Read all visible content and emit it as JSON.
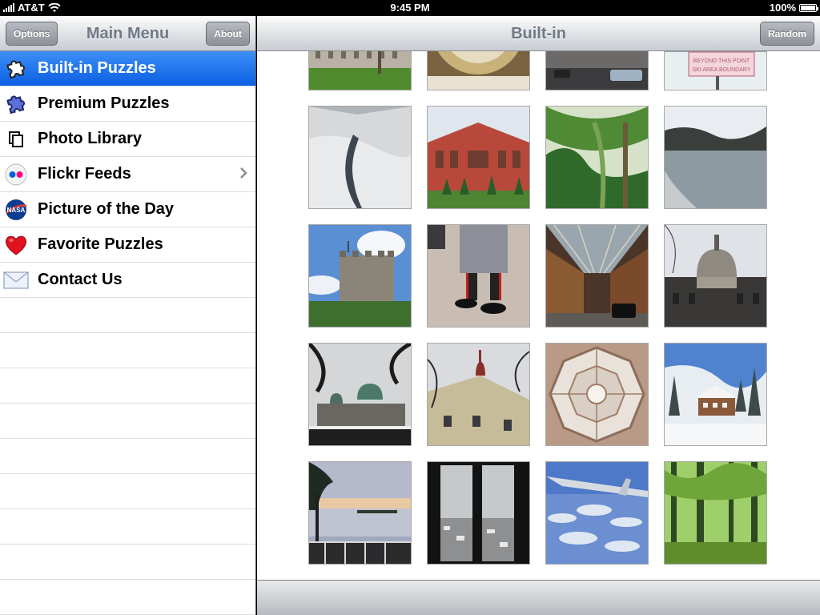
{
  "status_bar": {
    "carrier": "AT&T",
    "time": "9:45 PM",
    "battery": "100%",
    "battery_level": 1.0
  },
  "left_pane": {
    "options_button": "Options",
    "title": "Main Menu",
    "about_button": "About",
    "items": [
      {
        "label": "Built-in Puzzles",
        "icon": "puzzle-white-icon",
        "selected": true
      },
      {
        "label": "Premium Puzzles",
        "icon": "puzzle-blue-icon"
      },
      {
        "label": "Photo Library",
        "icon": "photo-library-icon"
      },
      {
        "label": "Flickr Feeds",
        "icon": "flickr-icon",
        "has_disclosure": true
      },
      {
        "label": "Picture of the Day",
        "icon": "nasa-icon"
      },
      {
        "label": "Favorite Puzzles",
        "icon": "heart-icon"
      },
      {
        "label": "Contact Us",
        "icon": "envelope-icon"
      }
    ]
  },
  "right_pane": {
    "title": "Built-in",
    "random_button": "Random",
    "thumbnails": [
      {
        "subject": "courtyard"
      },
      {
        "subject": "astronomical-clock"
      },
      {
        "subject": "street-cars"
      },
      {
        "subject": "ski-area-sign",
        "sign_text": [
          "BEYOND THIS POINT",
          "SKI AREA BOUNDARY"
        ]
      },
      {
        "subject": "aerial-snow-river"
      },
      {
        "subject": "red-brick-museum"
      },
      {
        "subject": "palm-garden"
      },
      {
        "subject": "fountain-pool"
      },
      {
        "subject": "round-castle-tower"
      },
      {
        "subject": "guard-boots"
      },
      {
        "subject": "covered-market"
      },
      {
        "subject": "domed-cathedral"
      },
      {
        "subject": "domes-silhouette"
      },
      {
        "subject": "snowy-church"
      },
      {
        "subject": "octagonal-dome-ceiling"
      },
      {
        "subject": "alpine-chalet"
      },
      {
        "subject": "sunset-lake"
      },
      {
        "subject": "window-snowy-town"
      },
      {
        "subject": "airplane-wing-clouds"
      },
      {
        "subject": "green-forest"
      }
    ]
  },
  "colors": {
    "selection_blue": "#1a6cf0",
    "nav_title_gray": "#707a86"
  }
}
